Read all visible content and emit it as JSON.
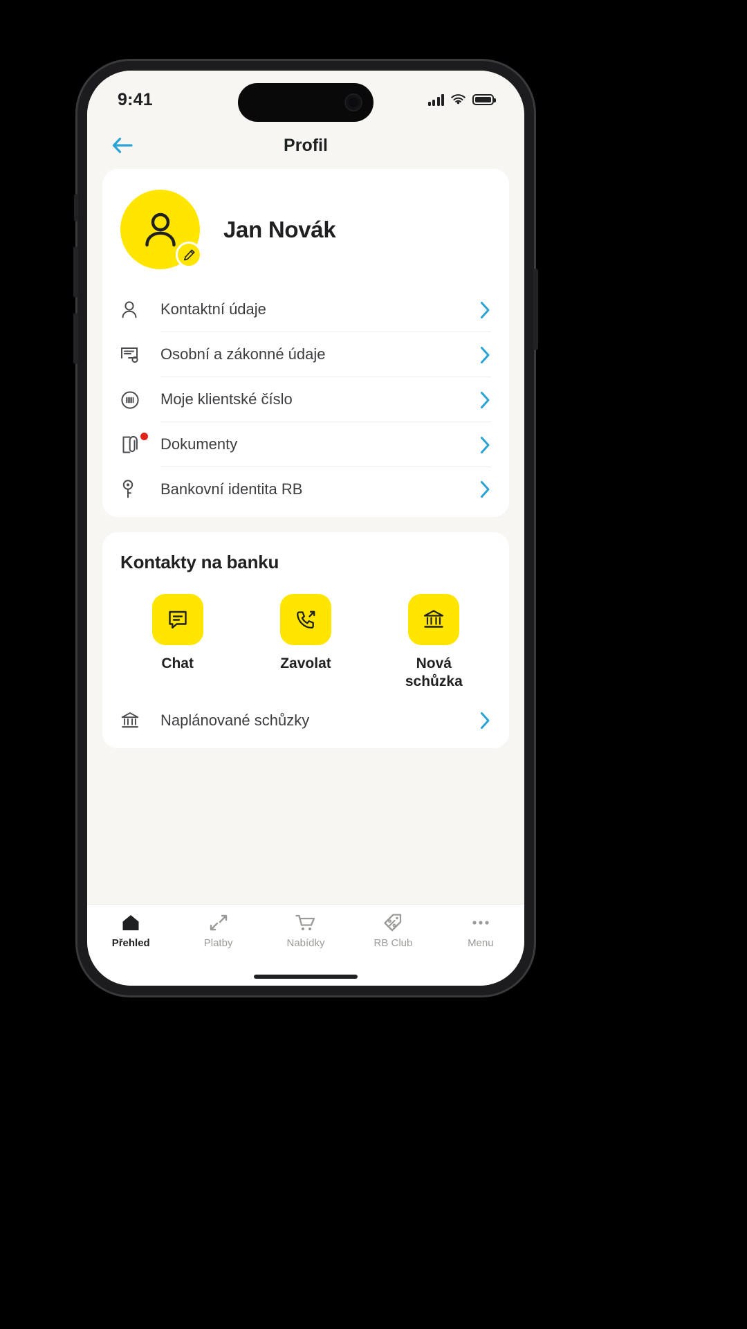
{
  "status_bar": {
    "time": "9:41",
    "signal_icon": "cellular-signal-icon",
    "wifi_icon": "wifi-icon",
    "battery_icon": "battery-icon"
  },
  "header": {
    "title": "Profil",
    "back_icon": "back-arrow-icon",
    "accent_color": "#2aa3d4"
  },
  "profile": {
    "name": "Jan Novák",
    "avatar_icon": "person-icon",
    "avatar_color": "#ffe500",
    "edit_icon": "pencil-icon"
  },
  "menu": {
    "items": [
      {
        "label": "Kontaktní údaje",
        "icon": "person-outline-icon",
        "badge": false
      },
      {
        "label": "Osobní a zákonné údaje",
        "icon": "id-card-icon",
        "badge": false
      },
      {
        "label": "Moje klientské číslo",
        "icon": "barcode-circle-icon",
        "badge": false
      },
      {
        "label": "Dokumenty",
        "icon": "document-attachment-icon",
        "badge": true
      },
      {
        "label": "Bankovní identita RB",
        "icon": "key-icon",
        "badge": false
      }
    ],
    "chevron_icon": "chevron-right-icon",
    "badge_color": "#e2231a"
  },
  "contacts": {
    "title": "Kontakty na banku",
    "actions": [
      {
        "label": "Chat",
        "icon": "chat-bubble-icon"
      },
      {
        "label": "Zavolat",
        "icon": "phone-outgoing-icon"
      },
      {
        "label": "Nová\nschůzka",
        "icon": "bank-building-icon"
      }
    ],
    "list": [
      {
        "label": "Naplánované schůzky",
        "icon": "bank-building-icon"
      }
    ]
  },
  "tab_bar": {
    "tabs": [
      {
        "label": "Přehled",
        "icon": "home-icon",
        "active": true
      },
      {
        "label": "Platby",
        "icon": "transfer-arrows-icon",
        "active": false
      },
      {
        "label": "Nabídky",
        "icon": "shopping-cart-icon",
        "active": false
      },
      {
        "label": "RB Club",
        "icon": "tag-percent-icon",
        "active": false
      },
      {
        "label": "Menu",
        "icon": "more-dots-icon",
        "active": false
      }
    ]
  }
}
